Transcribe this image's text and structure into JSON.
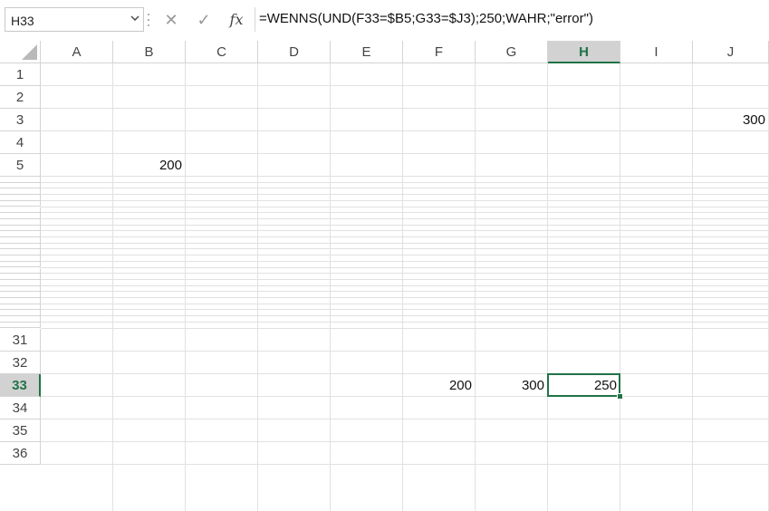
{
  "formula_bar": {
    "name_box": "H33",
    "cancel_icon": "✕",
    "enter_icon": "✓",
    "fx_label": "fx",
    "formula": "=WENNS(UND(F33=$B5;G33=$J3);250;WAHR;\"error\")"
  },
  "columns": [
    "A",
    "B",
    "C",
    "D",
    "E",
    "F",
    "G",
    "H",
    "I",
    "J"
  ],
  "active_column": "H",
  "rows": {
    "top": [
      "1",
      "2",
      "3",
      "4",
      "5"
    ],
    "bottom": [
      "31",
      "32",
      "33",
      "34",
      "35",
      "36"
    ]
  },
  "active_row": "33",
  "cells": {
    "B5": "200",
    "J3": "300",
    "F33": "200",
    "G33": "300",
    "H33": "250"
  },
  "selected_cell": "H33"
}
